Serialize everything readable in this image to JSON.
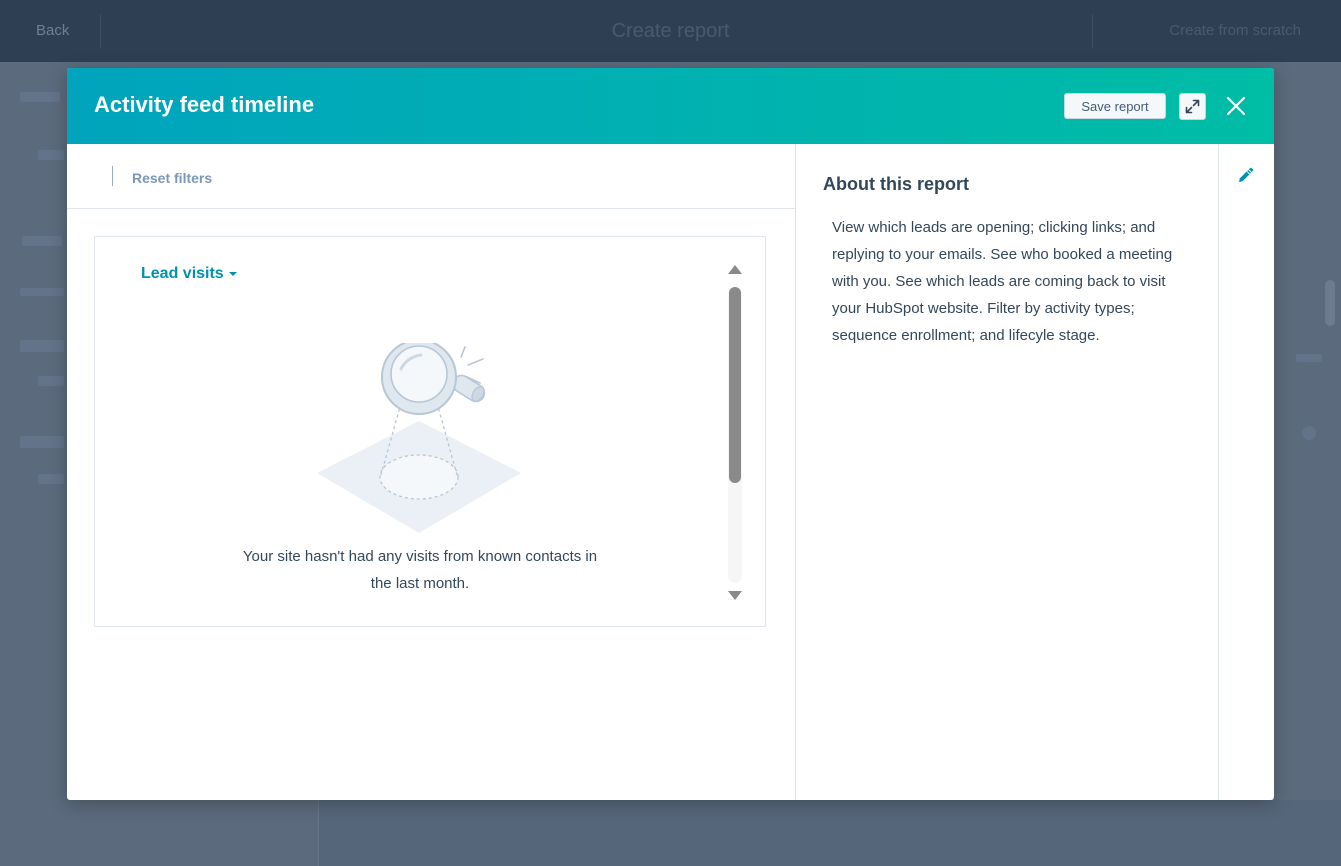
{
  "background": {
    "back_label": "Back",
    "title": "Create report",
    "right_label": "Create from scratch"
  },
  "modal": {
    "title": "Activity feed timeline",
    "save_label": "Save report",
    "icons": {
      "expand": "expand-arrows-icon",
      "close": "close-x-icon",
      "edit": "pencil-edit-icon",
      "dropdown": "caret-down-icon",
      "empty_state": "magnifying-glass-illustration"
    },
    "colors": {
      "header_start": "#00a4bd",
      "header_end": "#00bda5",
      "link": "#0091ae",
      "text": "#33475b"
    }
  },
  "filters": {
    "reset_label": "Reset filters"
  },
  "report": {
    "dropdown_label": "Lead visits",
    "empty_message": "Your site hasn't had any visits from known contacts in the last month."
  },
  "about": {
    "title": "About this report",
    "description": "View which leads are opening; clicking links; and replying to your emails. See who booked a meeting with you. See which leads are coming back to visit your HubSpot website. Filter by activity types; sequence enrollment; and lifecyle stage."
  }
}
